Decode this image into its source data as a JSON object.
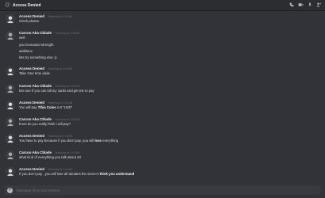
{
  "header": {
    "at_symbol": "@",
    "title": "Access Denied",
    "icons": [
      "phone-icon",
      "video-icon",
      "pin-icon",
      "add-member-icon"
    ]
  },
  "messages": [
    {
      "author": "Access Denied",
      "time": "Yesterday at 2:37 AM",
      "lines": [
        "check please."
      ]
    },
    {
      "author": "Carcoo Aka Cblade",
      "time": "Yesterday at 2:38 AM",
      "lines": [
        "well",
        "you increased strength",
        "welldone",
        "lets try something else :p"
      ]
    },
    {
      "author": "Access Denied",
      "time": "Yesterday at 2:38 AM",
      "lines": [
        "Take Your time dude"
      ]
    },
    {
      "author": "Carcoo Aka Cblade",
      "time": "Yesterday at 2:39 AM",
      "lines": [
        "lets see if you can kill my cards and get me to pay"
      ]
    },
    {
      "author": "Access Denied",
      "time": "Yesterday at 2:42 AM",
      "lines": [
        [
          "You will pay ",
          "Tibia Coins",
          " not \"USD\"",
          ""
        ]
      ]
    },
    {
      "author": "Carcoo Aka Cblade",
      "time": "Yesterday at 2:43 AM",
      "lines": [
        "hmm do you really think i will pay?"
      ]
    },
    {
      "author": "Access Denied",
      "time": "Yesterday at 2:43 AM",
      "lines": [
        [
          "You have to pay because if you don't pay, you will ",
          "lose",
          " everything",
          ""
        ]
      ]
    },
    {
      "author": "Carcoo Aka Cblade",
      "time": "Yesterday at 2:44 AM",
      "lines": [
        "what kind of everything you talk about xD"
      ]
    },
    {
      "author": "Access Denied",
      "time": "Yesterday at 2:44 AM",
      "lines": [
        [
          "If you don't pay , you will lose all donates the server ",
          "I think you understand",
          "",
          ""
        ]
      ]
    }
  ],
  "composer": {
    "placeholder": "Message @Access Denied",
    "plus": "+"
  },
  "colors": {
    "background": "#313338",
    "header": "#2b2d31",
    "composer": "#383a40"
  }
}
